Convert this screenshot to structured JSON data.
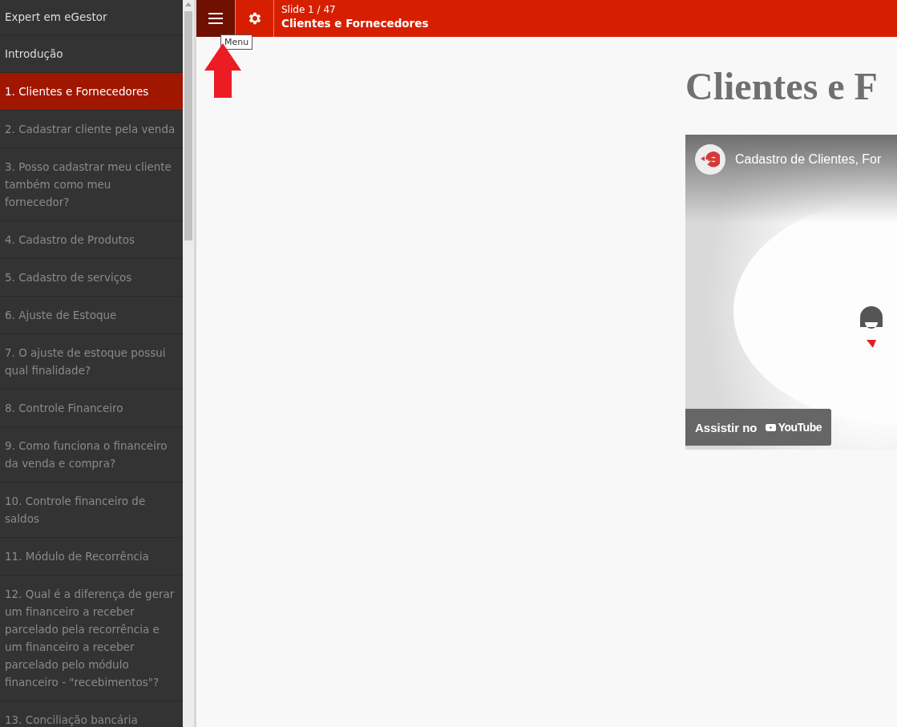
{
  "sidebar": {
    "title": "Expert em eGestor",
    "items": [
      {
        "label": "Introdução",
        "selected": false,
        "disabled": false
      },
      {
        "label": "1. Clientes e Fornecedores",
        "selected": true,
        "disabled": false
      },
      {
        "label": "2. Cadastrar cliente pela venda",
        "selected": false,
        "disabled": true
      },
      {
        "label": "3. Posso cadastrar meu cliente também como meu fornecedor?",
        "selected": false,
        "disabled": true
      },
      {
        "label": "4. Cadastro de Produtos",
        "selected": false,
        "disabled": true
      },
      {
        "label": "5. Cadastro de serviços",
        "selected": false,
        "disabled": true
      },
      {
        "label": "6. Ajuste de Estoque",
        "selected": false,
        "disabled": true
      },
      {
        "label": "7. O ajuste de estoque possui qual finalidade?",
        "selected": false,
        "disabled": true
      },
      {
        "label": "8. Controle Financeiro",
        "selected": false,
        "disabled": true
      },
      {
        "label": "9. Como funciona o financeiro da venda e compra?",
        "selected": false,
        "disabled": true
      },
      {
        "label": "10. Controle financeiro de saldos",
        "selected": false,
        "disabled": true
      },
      {
        "label": "11. Módulo de Recorrência",
        "selected": false,
        "disabled": true
      },
      {
        "label": "12. Qual é a diferença de gerar um financeiro a receber parcelado pela recorrência e um financeiro a receber parcelado pelo módulo financeiro - \"recebimentos\"?",
        "selected": false,
        "disabled": true
      },
      {
        "label": "13. Conciliação bancária",
        "selected": false,
        "disabled": true
      }
    ]
  },
  "toolbar": {
    "slide_counter": "Slide 1 / 47",
    "slide_title": "Clientes e Fornecedores",
    "tooltip": "Menu"
  },
  "slide": {
    "heading": "Clientes e F",
    "video": {
      "title": "Cadastro de Clientes, For",
      "watch_label": "Assistir no",
      "platform": "YouTube"
    }
  }
}
